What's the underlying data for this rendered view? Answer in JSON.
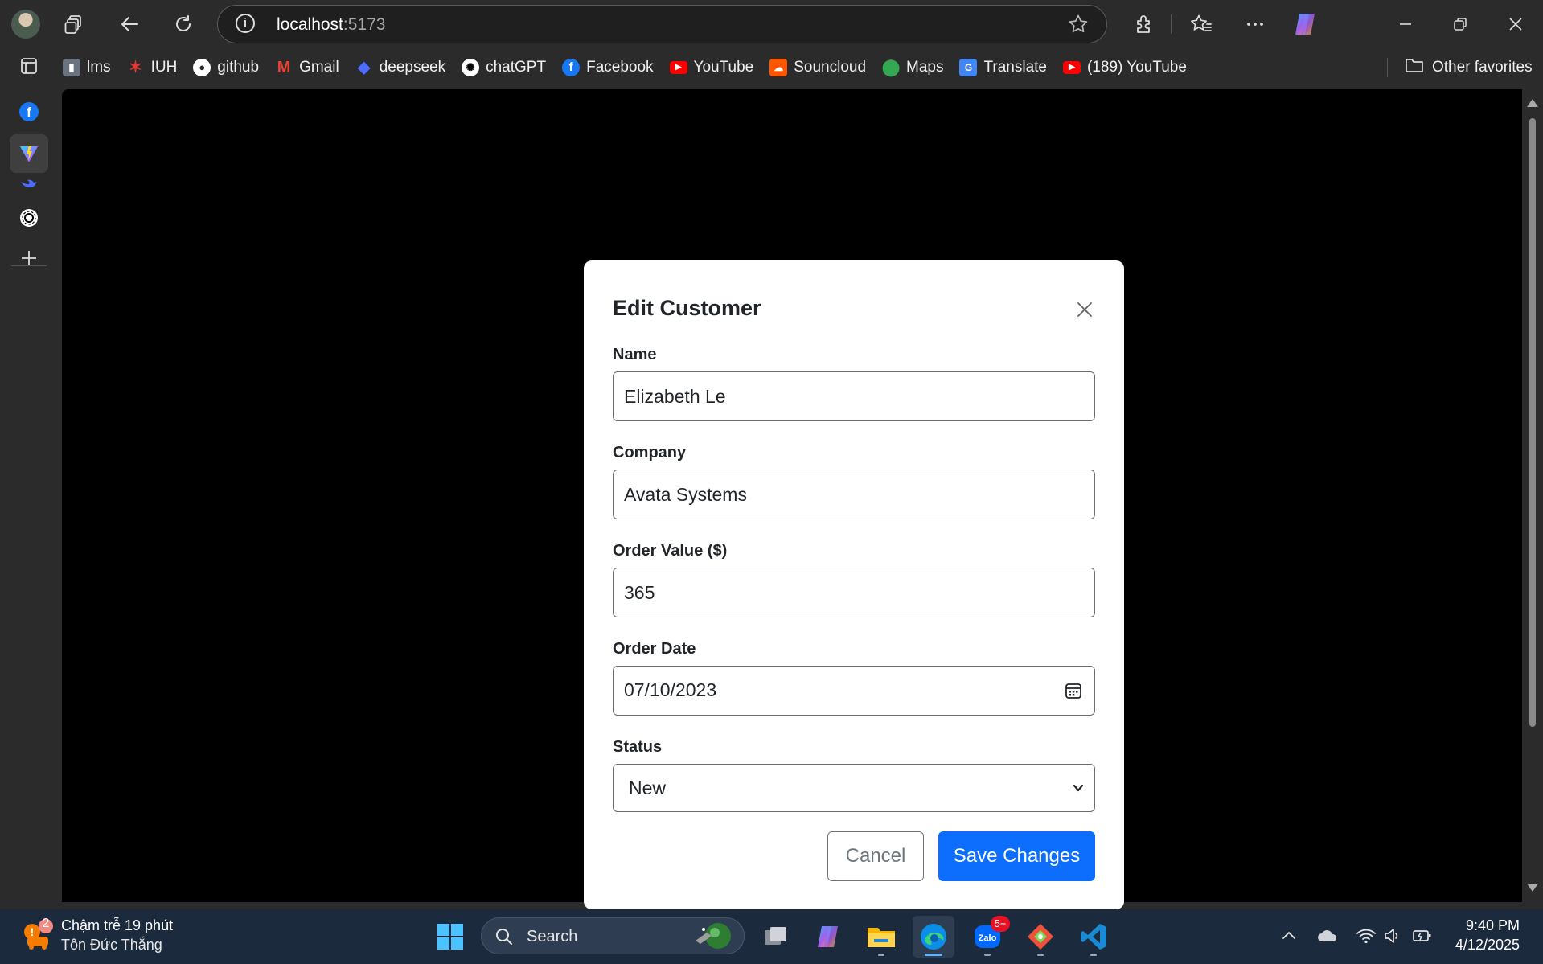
{
  "browser": {
    "url_host": "localhost",
    "url_port": ":5173",
    "bookmarks": [
      {
        "label": "lms",
        "icon": "lms-icon",
        "color": "#6b7280"
      },
      {
        "label": "IUH",
        "icon": "iuh-icon",
        "color": "#c62828"
      },
      {
        "label": "github",
        "icon": "github-icon",
        "color": "#24292e"
      },
      {
        "label": "Gmail",
        "icon": "gmail-icon",
        "color": "#ea4335"
      },
      {
        "label": "deepseek",
        "icon": "deepseek-icon",
        "color": "#4d6bfe"
      },
      {
        "label": "chatGPT",
        "icon": "chatgpt-icon",
        "color": "#ffffff"
      },
      {
        "label": "Facebook",
        "icon": "facebook-icon",
        "color": "#1877f2"
      },
      {
        "label": "YouTube",
        "icon": "youtube-icon",
        "color": "#ff0000"
      },
      {
        "label": "Souncloud",
        "icon": "soundcloud-icon",
        "color": "#ff5500"
      },
      {
        "label": "Maps",
        "icon": "maps-icon",
        "color": "#34a853"
      },
      {
        "label": "Translate",
        "icon": "translate-icon",
        "color": "#4285f4"
      },
      {
        "label": "(189) YouTube",
        "icon": "youtube-icon",
        "color": "#ff0000"
      }
    ],
    "other_favorites": "Other favorites"
  },
  "modal": {
    "title": "Edit Customer",
    "fields": {
      "name_label": "Name",
      "name_value": "Elizabeth Le",
      "company_label": "Company",
      "company_value": "Avata Systems",
      "order_value_label": "Order Value ($)",
      "order_value_value": "365",
      "order_date_label": "Order Date",
      "order_date_value": "07/10/2023",
      "status_label": "Status",
      "status_value": "New"
    },
    "cancel_label": "Cancel",
    "save_label": "Save Changes",
    "accent_color": "#0d6efd"
  },
  "taskbar": {
    "notification_badge": "2",
    "notification_title": "Chậm trễ 19 phút",
    "notification_subtitle": "Tôn Đức Thắng",
    "search_label": "Search",
    "zalo_badge": "5+",
    "time": "9:40 PM",
    "date": "4/12/2025"
  }
}
